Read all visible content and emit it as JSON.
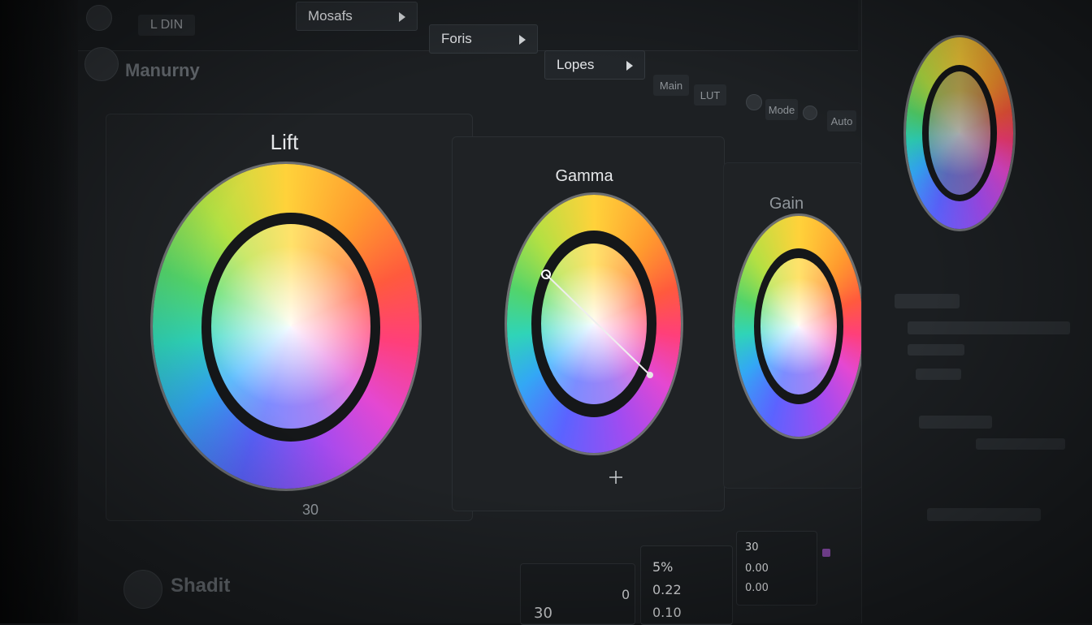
{
  "tabs": [
    {
      "label": "Mosafs"
    },
    {
      "label": "Foris"
    },
    {
      "label": "Lopes"
    }
  ],
  "topbar_left_label": "L DIN",
  "section_top_label": "Manurny",
  "section_bottom_label": "Shadit",
  "toolbar_chips": [
    "Main",
    "LUT",
    "Mode",
    "Auto"
  ],
  "wheels": {
    "lift": {
      "label": "Lift",
      "value": "30"
    },
    "gamma": {
      "label": "Gamma"
    },
    "gain": {
      "label": "Gain"
    }
  },
  "readouts": {
    "box1_value": "30",
    "box2_value": "0",
    "box3_values": [
      "5%",
      "0.22",
      "0.10"
    ],
    "box4_values": [
      "30",
      "0.00",
      "0.00"
    ]
  },
  "colors": {
    "accent_green": "#3fae4a",
    "accent_purple": "#b45de0",
    "panel_bg": "#1f2225"
  }
}
